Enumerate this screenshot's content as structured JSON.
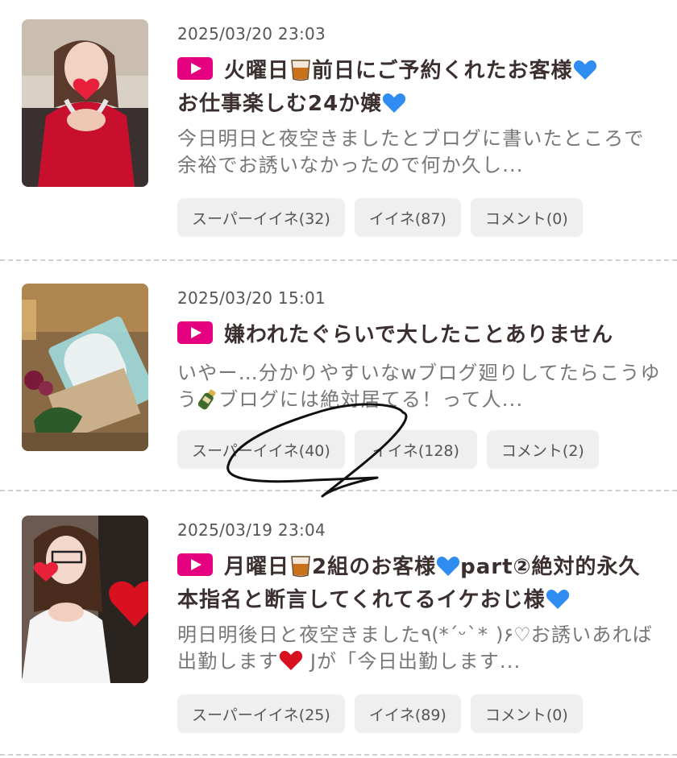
{
  "posts": [
    {
      "date": "2025/03/20 23:03",
      "title_parts": [
        "火曜日",
        "前日にご予約くれたお客様",
        "お仕事楽しむ24か嬢"
      ],
      "excerpt": "今日明日と夜空きましたとブログに書いたところで 余裕でお誘いなかったので何か久し...",
      "buttons": {
        "super_like": "スーパーイイネ(32)",
        "like": "イイネ(87)",
        "comment": "コメント(0)"
      }
    },
    {
      "date": "2025/03/20 15:01",
      "title_parts": [
        "嫌われたぐらいで大したことありません"
      ],
      "excerpt_parts": [
        " いやー…分かりやすいなwブログ廻りしてたらこうゆう",
        "ブログには絶対居てる！って人..."
      ],
      "buttons": {
        "super_like": "スーパーイイネ(40)",
        "like": "イイネ(128)",
        "comment": "コメント(2)"
      }
    },
    {
      "date": "2025/03/19 23:04",
      "title_parts": [
        "月曜日",
        "2組のお客様",
        "part②絶対的永久本指名と断言してくれてるイケおじ様"
      ],
      "excerpt_parts": [
        "明日明後日と夜空きました٩(*ˊᵕˋ* )۶♡お誘いあれば出勤します",
        " Jが「今日出勤します..."
      ],
      "buttons": {
        "super_like": "スーパーイイネ(25)",
        "like": "イイネ(89)",
        "comment": "コメント(0)"
      }
    }
  ],
  "icons": {
    "play": "play-icon",
    "whisky": "whisky-glass-icon",
    "blue_heart": "blue-heart-icon",
    "red_heart": "red-heart-icon",
    "champagne": "champagne-icon"
  },
  "colors": {
    "accent": "#e4007f",
    "button_bg": "#efefef",
    "title": "#3b2f2f",
    "excerpt": "#777777",
    "divider": "#cfcfcf"
  }
}
